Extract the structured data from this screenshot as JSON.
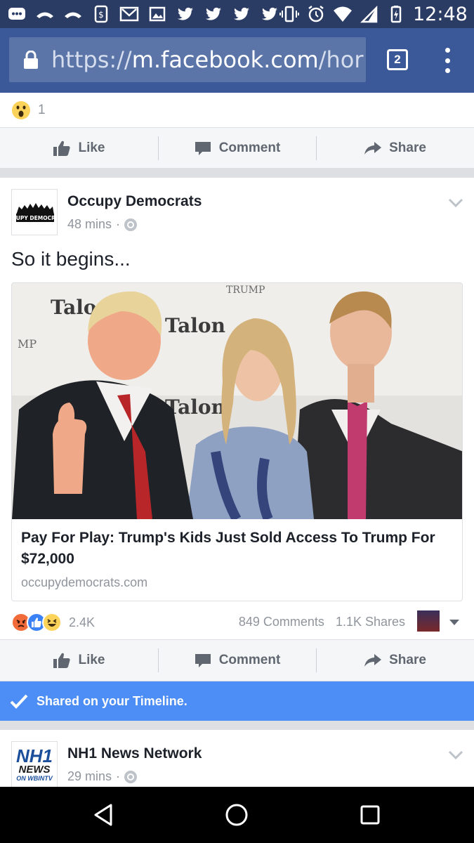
{
  "status_bar": {
    "time": "12:48",
    "icons": [
      "chat-icon",
      "missed-call-icon",
      "missed-call-icon",
      "phone-alert-icon",
      "gmail-icon",
      "image-icon",
      "twitter-icon",
      "twitter-icon",
      "twitter-icon",
      "twitter-icon",
      "vibrate-icon",
      "alarm-icon",
      "wifi-icon",
      "signal-icon",
      "battery-icon"
    ]
  },
  "browser": {
    "url_scheme": "https://",
    "url_host": "m.facebook.com",
    "url_path": "/hor",
    "tab_count": "2"
  },
  "prev_post": {
    "reaction_count": "1",
    "actions": {
      "like": "Like",
      "comment": "Comment",
      "share": "Share"
    }
  },
  "post": {
    "page_name": "Occupy Democrats",
    "avatar_text": "OCCUPY DEMOCRATS",
    "time": "48 mins",
    "separator": "·",
    "text": "So it begins...",
    "link_title": "Pay For Play: Trump's Kids Just Sold Access To Trump For $72,000",
    "link_domain": "occupydemocrats.com",
    "photo_signs": [
      "Talon",
      "Talon",
      "Talon",
      "TRUMP",
      "MP"
    ],
    "reaction_total": "2.4K",
    "comments": "849 Comments",
    "shares": "1.1K Shares",
    "actions": {
      "like": "Like",
      "comment": "Comment",
      "share": "Share"
    }
  },
  "shared_banner": "Shared on your Timeline.",
  "next_post": {
    "page_name": "NH1 News Network",
    "time": "29 mins",
    "separator": "·",
    "avatar_logo": "NH1",
    "avatar_sub": "NEWS",
    "avatar_sub2": "ON WBINTV"
  },
  "colors": {
    "status_bar": "#2a3b64",
    "toolbar": "#3b5998",
    "shared_banner": "#4c8df6",
    "action_text": "#606770",
    "meta_text": "#90949c"
  }
}
